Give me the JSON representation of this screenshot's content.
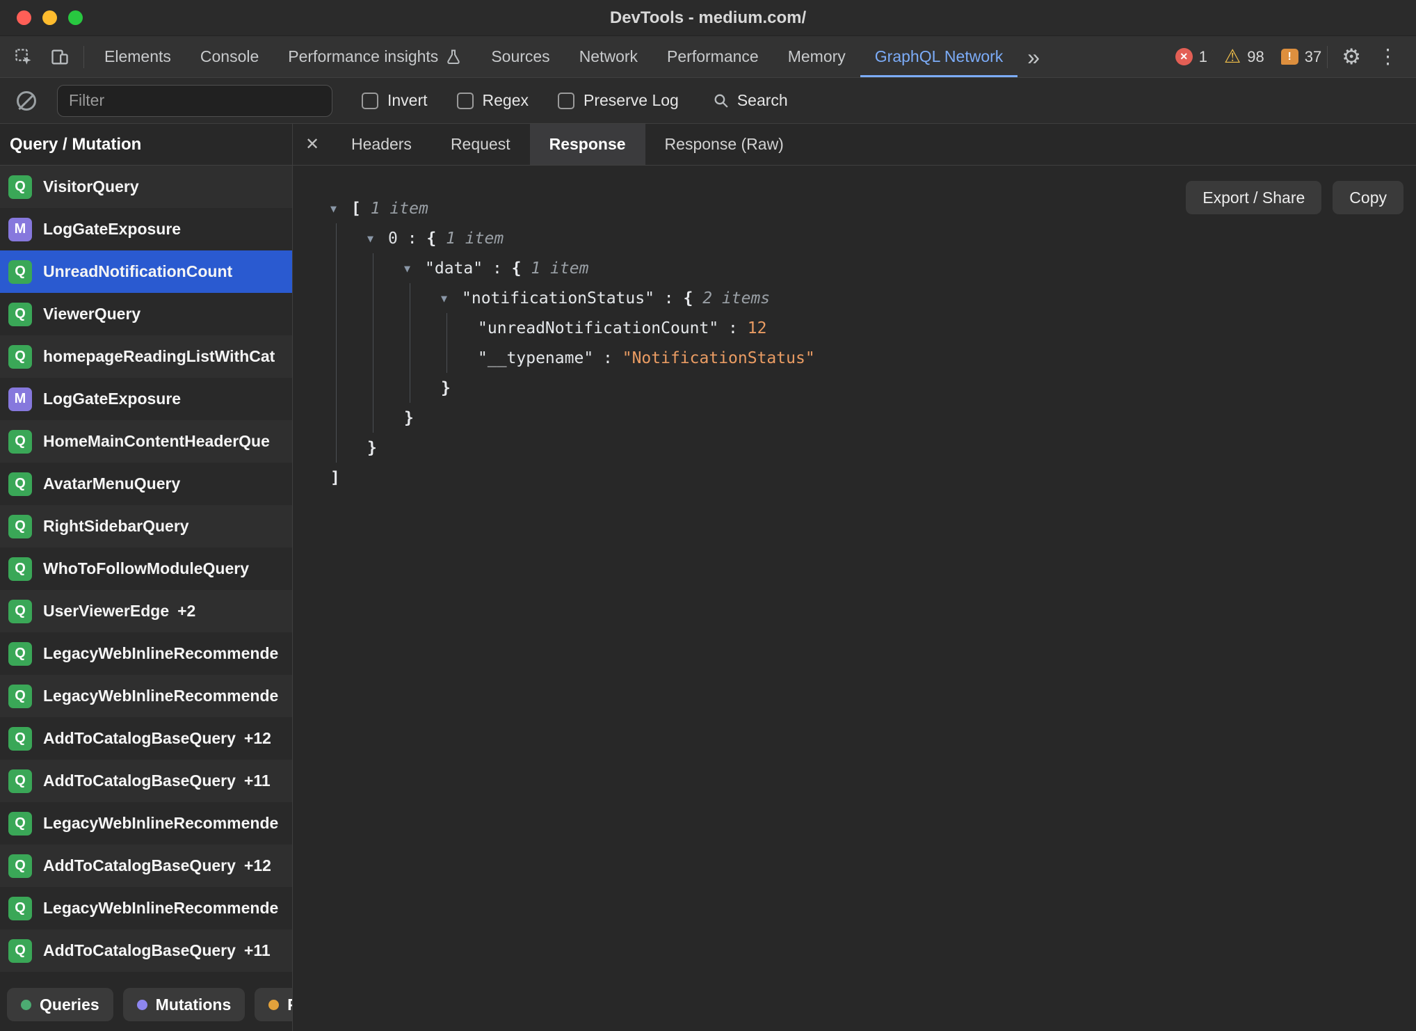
{
  "window": {
    "title": "DevTools - medium.com/"
  },
  "colors": {
    "accent_blue": "#7cacf8",
    "selection_blue": "#2a5ad0",
    "query_badge_green": "#3aa757",
    "mutation_badge_purple": "#8678dd",
    "number_orange": "#ea9c63"
  },
  "icons": {
    "overflow": "»",
    "gear": "⚙",
    "kebab": "⋮",
    "close": "✕",
    "caret_down": "▼",
    "warning": "⚠",
    "error_x": "✕",
    "issue_mark": "!"
  },
  "tabbar": {
    "tabs": [
      {
        "label": "Elements"
      },
      {
        "label": "Console"
      },
      {
        "label": "Performance insights"
      },
      {
        "label": "Sources"
      },
      {
        "label": "Network"
      },
      {
        "label": "Performance"
      },
      {
        "label": "Memory"
      },
      {
        "label": "GraphQL Network"
      }
    ],
    "error_count": "1",
    "warning_count": "98",
    "issue_count": "37"
  },
  "toolbar": {
    "filter_placeholder": "Filter",
    "checkboxes": [
      {
        "label": "Invert"
      },
      {
        "label": "Regex"
      },
      {
        "label": "Preserve Log"
      }
    ],
    "search_label": "Search"
  },
  "sidebar": {
    "header": "Query / Mutation",
    "items": [
      {
        "type": "Q",
        "label": "VisitorQuery"
      },
      {
        "type": "M",
        "label": "LogGateExposure"
      },
      {
        "type": "Q",
        "label": "UnreadNotificationCount",
        "selected": true
      },
      {
        "type": "Q",
        "label": "ViewerQuery"
      },
      {
        "type": "Q",
        "label": "homepageReadingListWithCat"
      },
      {
        "type": "M",
        "label": "LogGateExposure"
      },
      {
        "type": "Q",
        "label": "HomeMainContentHeaderQue"
      },
      {
        "type": "Q",
        "label": "AvatarMenuQuery"
      },
      {
        "type": "Q",
        "label": "RightSidebarQuery"
      },
      {
        "type": "Q",
        "label": "WhoToFollowModuleQuery"
      },
      {
        "type": "Q",
        "label": "UserViewerEdge",
        "suffix": "+2"
      },
      {
        "type": "Q",
        "label": "LegacyWebInlineRecommende"
      },
      {
        "type": "Q",
        "label": "LegacyWebInlineRecommende"
      },
      {
        "type": "Q",
        "label": "AddToCatalogBaseQuery",
        "suffix": "+12"
      },
      {
        "type": "Q",
        "label": "AddToCatalogBaseQuery",
        "suffix": "+11"
      },
      {
        "type": "Q",
        "label": "LegacyWebInlineRecommende"
      },
      {
        "type": "Q",
        "label": "AddToCatalogBaseQuery",
        "suffix": "+12"
      },
      {
        "type": "Q",
        "label": "LegacyWebInlineRecommende"
      },
      {
        "type": "Q",
        "label": "AddToCatalogBaseQuery",
        "suffix": "+11"
      }
    ],
    "filters": [
      {
        "label": "Queries",
        "color": "#4cab72"
      },
      {
        "label": "Mutations",
        "color": "#8d86f0"
      },
      {
        "label": "Pers",
        "color": "#e3a23b"
      }
    ]
  },
  "detail": {
    "tabs": [
      {
        "label": "Headers"
      },
      {
        "label": "Request"
      },
      {
        "label": "Response"
      },
      {
        "label": "Response (Raw)"
      }
    ],
    "export_label": "Export / Share",
    "copy_label": "Copy",
    "tree": [
      {
        "indent": 0,
        "caret": true,
        "guides": [],
        "tokens": [
          {
            "t": "punct",
            "v": "[ "
          },
          {
            "t": "meta",
            "v": "1 item"
          }
        ]
      },
      {
        "indent": 1,
        "caret": true,
        "guides": [
          0
        ],
        "tokens": [
          {
            "t": "idx",
            "v": "0"
          },
          {
            "t": "colon",
            "v": " : "
          },
          {
            "t": "punct",
            "v": "{ "
          },
          {
            "t": "meta",
            "v": "1 item"
          }
        ]
      },
      {
        "indent": 2,
        "caret": true,
        "guides": [
          0,
          1
        ],
        "tokens": [
          {
            "t": "key",
            "v": "\"data\""
          },
          {
            "t": "colon",
            "v": " : "
          },
          {
            "t": "punct",
            "v": "{ "
          },
          {
            "t": "meta",
            "v": "1 item"
          }
        ]
      },
      {
        "indent": 3,
        "caret": true,
        "guides": [
          0,
          1,
          2
        ],
        "tokens": [
          {
            "t": "key",
            "v": "\"notificationStatus\""
          },
          {
            "t": "colon",
            "v": " : "
          },
          {
            "t": "punct",
            "v": "{ "
          },
          {
            "t": "meta",
            "v": "2 items"
          }
        ]
      },
      {
        "indent": 4,
        "caret": false,
        "guides": [
          0,
          1,
          2,
          3
        ],
        "tokens": [
          {
            "t": "key",
            "v": "\"unreadNotificationCount\""
          },
          {
            "t": "colon",
            "v": " : "
          },
          {
            "t": "num",
            "v": "12"
          }
        ]
      },
      {
        "indent": 4,
        "caret": false,
        "guides": [
          0,
          1,
          2,
          3
        ],
        "tokens": [
          {
            "t": "key",
            "v": "\"__typename\""
          },
          {
            "t": "colon",
            "v": " : "
          },
          {
            "t": "str",
            "v": "\"NotificationStatus\""
          }
        ]
      },
      {
        "indent": 3,
        "caret": false,
        "guides": [
          0,
          1,
          2
        ],
        "tokens": [
          {
            "t": "punct",
            "v": "}"
          }
        ]
      },
      {
        "indent": 2,
        "caret": false,
        "guides": [
          0,
          1
        ],
        "tokens": [
          {
            "t": "punct",
            "v": "}"
          }
        ]
      },
      {
        "indent": 1,
        "caret": false,
        "guides": [
          0
        ],
        "tokens": [
          {
            "t": "punct",
            "v": "}"
          }
        ]
      },
      {
        "indent": 0,
        "caret": false,
        "guides": [],
        "tokens": [
          {
            "t": "punct",
            "v": "]"
          }
        ]
      }
    ]
  }
}
